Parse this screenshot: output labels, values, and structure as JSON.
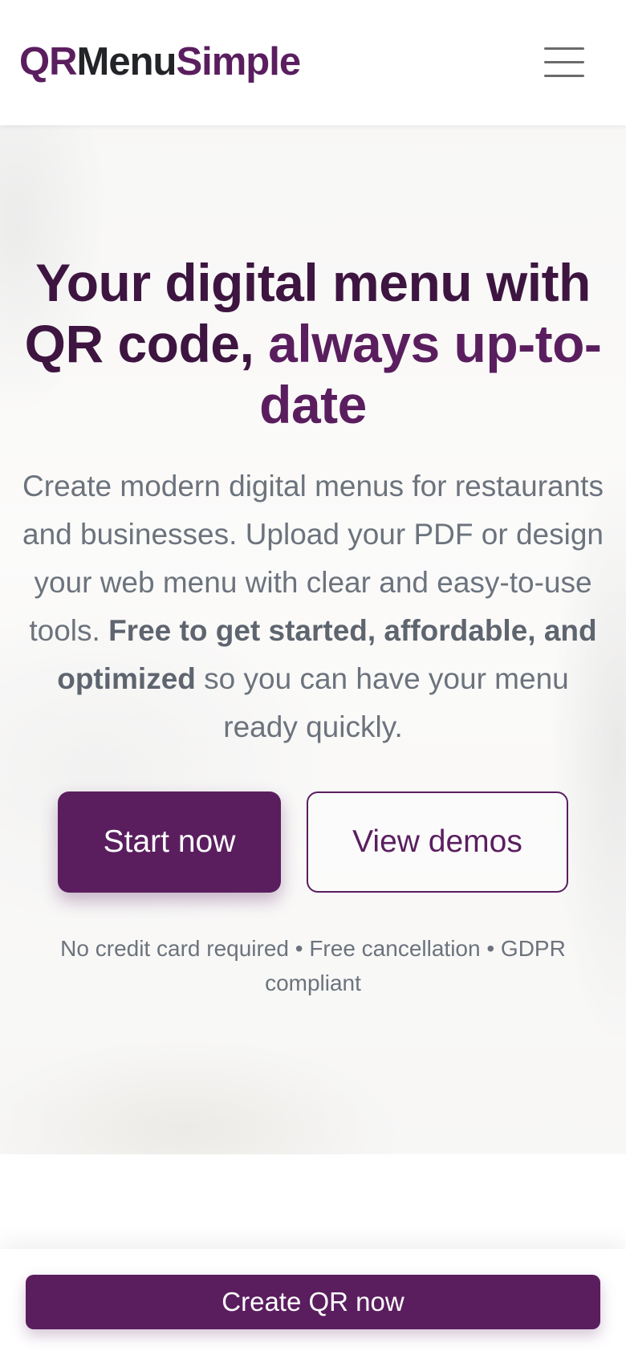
{
  "header": {
    "logo": {
      "part1": "QR",
      "part2": "Menu",
      "part3": "Simple"
    },
    "menu_icon": "hamburger-menu-icon"
  },
  "hero": {
    "title_main": "Your digital menu with QR code, ",
    "title_highlight": "always up-to-date",
    "description_start": "Create modern digital menus for restaurants and businesses. Upload your PDF or design your web menu with clear and easy-to-use tools. ",
    "description_bold": "Free to get started, affordable, and optimized",
    "description_end": " so you can have your menu ready quickly.",
    "primary_button": "Start now",
    "secondary_button": "View demos",
    "note": "No credit card required • Free cancellation • GDPR compliant"
  },
  "bottom_bar": {
    "cta_label": "Create QR now"
  },
  "colors": {
    "brand": "#5a1e5f",
    "brand_dark": "#3d1540",
    "text_muted": "#6c737d",
    "logo_dark": "#222428"
  }
}
